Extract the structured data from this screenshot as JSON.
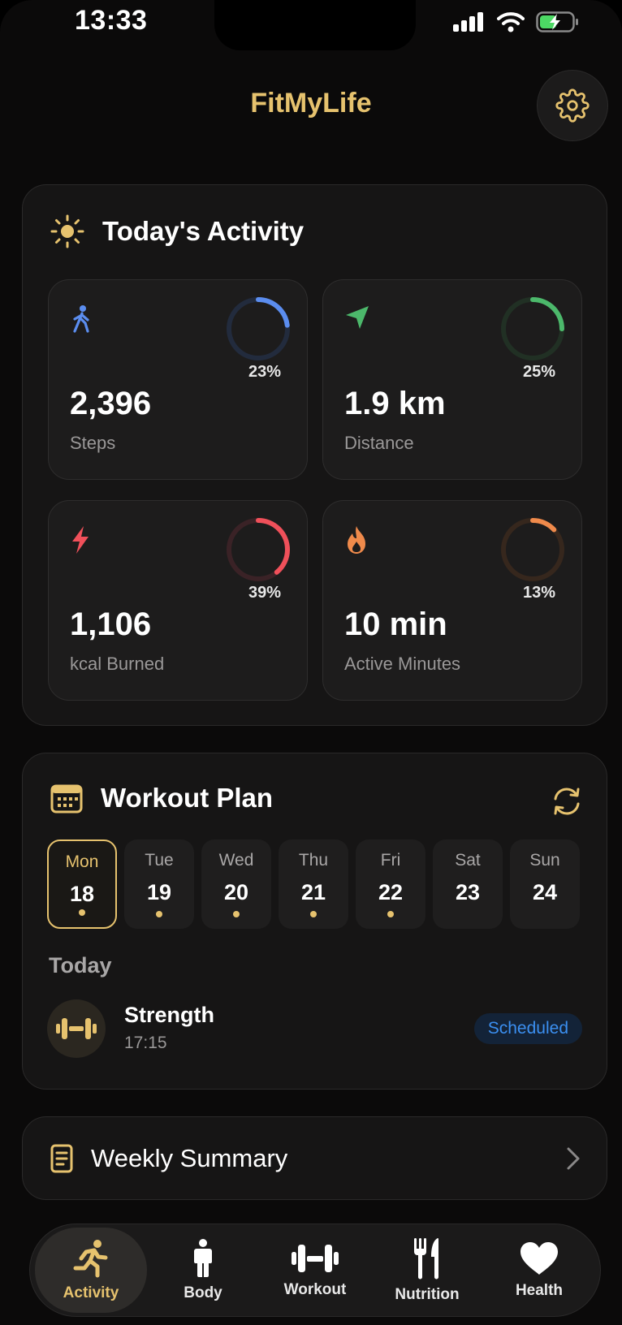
{
  "status_bar": {
    "time": "13:33"
  },
  "header": {
    "title": "FitMyLife"
  },
  "activity": {
    "title": "Today's Activity",
    "metrics": [
      {
        "value": "2,396",
        "label": "Steps",
        "percent_label": "23%",
        "progress": 0.23,
        "color": "#5b8def",
        "track": "#222b3d",
        "icon": "walking-icon"
      },
      {
        "value": "1.9 km",
        "label": "Distance",
        "percent_label": "25%",
        "progress": 0.25,
        "color": "#4cb86b",
        "track": "#213024",
        "icon": "location-arrow-icon"
      },
      {
        "value": "1,106",
        "label": "kcal Burned",
        "percent_label": "39%",
        "progress": 0.39,
        "color": "#f0505a",
        "track": "#3a2226",
        "icon": "lightning-icon"
      },
      {
        "value": "10 min",
        "label": "Active Minutes",
        "percent_label": "13%",
        "progress": 0.13,
        "color": "#ef8a4b",
        "track": "#36271d",
        "icon": "flame-icon"
      }
    ]
  },
  "plan": {
    "title": "Workout Plan",
    "days": [
      {
        "name": "Mon",
        "num": "18",
        "dot": true,
        "active": true
      },
      {
        "name": "Tue",
        "num": "19",
        "dot": true,
        "active": false
      },
      {
        "name": "Wed",
        "num": "20",
        "dot": true,
        "active": false
      },
      {
        "name": "Thu",
        "num": "21",
        "dot": true,
        "active": false
      },
      {
        "name": "Fri",
        "num": "22",
        "dot": true,
        "active": false
      },
      {
        "name": "Sat",
        "num": "23",
        "dot": false,
        "active": false
      },
      {
        "name": "Sun",
        "num": "24",
        "dot": false,
        "active": false
      }
    ],
    "today_label": "Today",
    "workout": {
      "name": "Strength",
      "time": "17:15",
      "status": "Scheduled"
    }
  },
  "weekly": {
    "label": "Weekly Summary"
  },
  "tabs": [
    {
      "label": "Activity",
      "icon": "running-icon",
      "active": true
    },
    {
      "label": "Body",
      "icon": "person-icon",
      "active": false
    },
    {
      "label": "Workout",
      "icon": "dumbbell-icon",
      "active": false
    },
    {
      "label": "Nutrition",
      "icon": "fork-knife-icon",
      "active": false
    },
    {
      "label": "Health",
      "icon": "heart-icon",
      "active": false
    }
  ],
  "colors": {
    "accent": "#e6c26e",
    "badge": "#3b8ff0"
  }
}
